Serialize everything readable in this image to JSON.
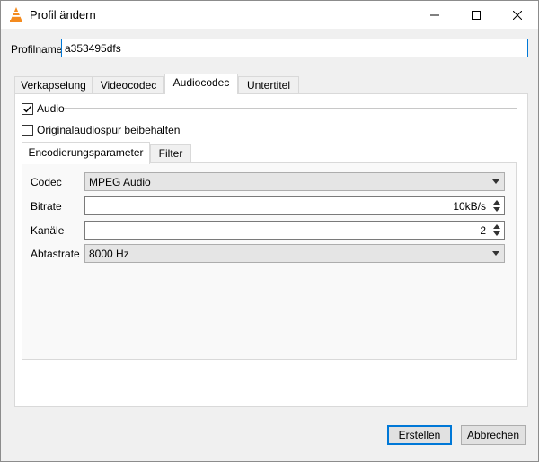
{
  "window": {
    "title": "Profil ändern",
    "controls": [
      "minimize-icon",
      "maximize-icon",
      "close-icon"
    ]
  },
  "profile": {
    "label": "Profilname",
    "value": "a353495dfs"
  },
  "tabs": [
    {
      "label": "Verkapselung",
      "active": false
    },
    {
      "label": "Videocodec",
      "active": false
    },
    {
      "label": "Audiocodec",
      "active": true
    },
    {
      "label": "Untertitel",
      "active": false
    }
  ],
  "audio": {
    "enabled_label": "Audio",
    "enabled_checked": true,
    "keep_original_label": "Originalaudiospur beibehalten",
    "keep_original_checked": false
  },
  "subtabs": [
    {
      "label": "Encodierungsparameter",
      "active": true
    },
    {
      "label": "Filter",
      "active": false
    }
  ],
  "form": {
    "codec": {
      "label": "Codec",
      "value": "MPEG Audio"
    },
    "bitrate": {
      "label": "Bitrate",
      "value": "10kB/s"
    },
    "channels": {
      "label": "Kanäle",
      "value": "2"
    },
    "samplerate": {
      "label": "Abtastrate",
      "value": "8000 Hz"
    }
  },
  "buttons": {
    "create": "Erstellen",
    "cancel": "Abbrechen"
  },
  "colors": {
    "accent": "#0078d7",
    "vlc_orange": "#f48b1f"
  }
}
